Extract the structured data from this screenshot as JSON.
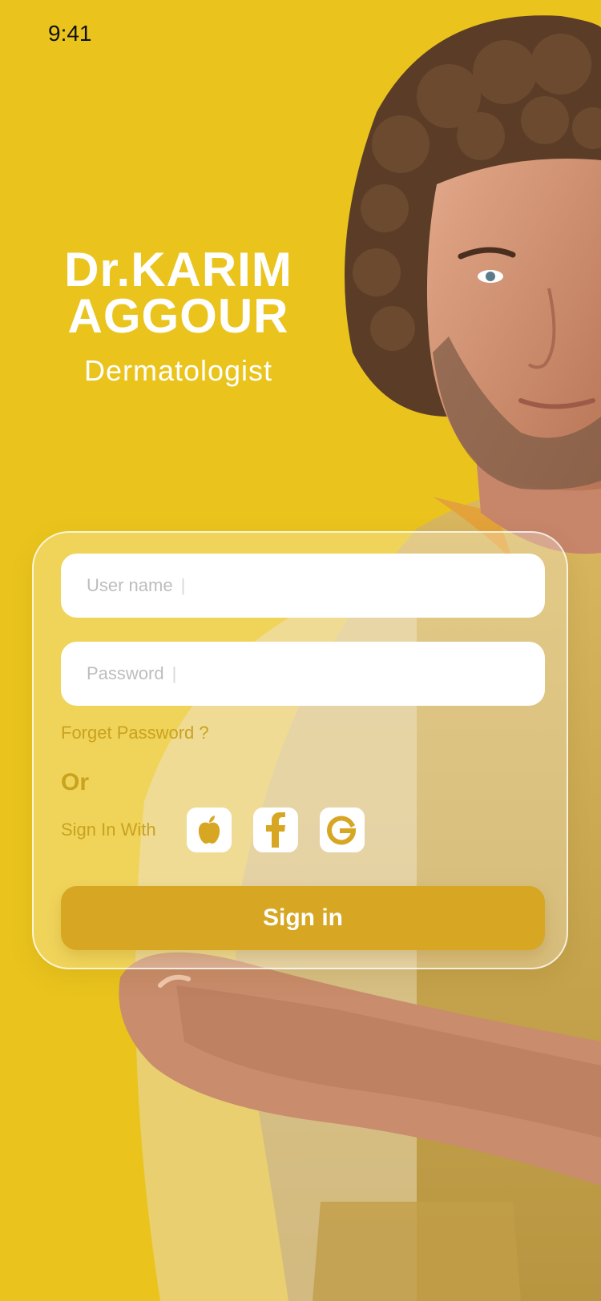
{
  "status_bar": {
    "time": "9:41"
  },
  "doctor": {
    "name_line1": "Dr.KARIM",
    "name_line2": "AGGOUR",
    "specialty": "Dermatologist"
  },
  "login": {
    "username_placeholder": "User name",
    "password_placeholder": "Password",
    "caret": "|",
    "forget_password": "Forget Password ?",
    "or_label": "Or",
    "sign_in_with": "Sign In With",
    "social": [
      {
        "icon": "apple-icon"
      },
      {
        "icon": "facebook-icon"
      },
      {
        "icon": "google-icon"
      }
    ],
    "sign_in_button": "Sign in"
  },
  "colors": {
    "background": "#EAC41D",
    "accent": "#D7A623",
    "accent_text": "#C9A21E",
    "white": "#FFFFFF"
  }
}
